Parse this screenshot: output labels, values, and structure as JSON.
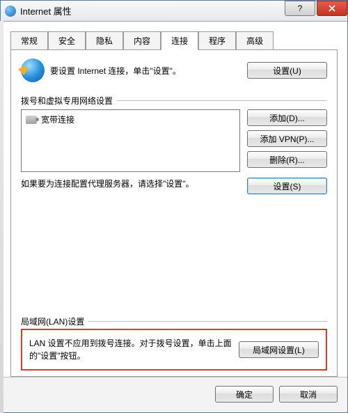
{
  "window": {
    "title": "Internet 属性"
  },
  "tabs": {
    "items": [
      {
        "label": "常规"
      },
      {
        "label": "安全"
      },
      {
        "label": "隐私"
      },
      {
        "label": "内容"
      },
      {
        "label": "连接"
      },
      {
        "label": "程序"
      },
      {
        "label": "高级"
      }
    ],
    "active_index": 4
  },
  "setup_row": {
    "text": "要设置 Internet 连接，单击\"设置\"。",
    "button": "设置(U)"
  },
  "dialup": {
    "group_label": "拨号和虚拟专用网络设置",
    "connections": [
      {
        "name": "宽带连接"
      }
    ],
    "add_btn": "添加(D)...",
    "add_vpn_btn": "添加 VPN(P)...",
    "remove_btn": "删除(R)...",
    "proxy_text": "如果要为连接配置代理服务器，请选择\"设置\"。",
    "settings_btn": "设置(S)"
  },
  "lan": {
    "group_label": "局域网(LAN)设置",
    "text": "LAN 设置不应用到拨号连接。对于拨号设置，单击上面的\"设置\"按钮。",
    "button": "局域网设置(L)"
  },
  "footer": {
    "ok": "确定",
    "cancel": "取消"
  }
}
